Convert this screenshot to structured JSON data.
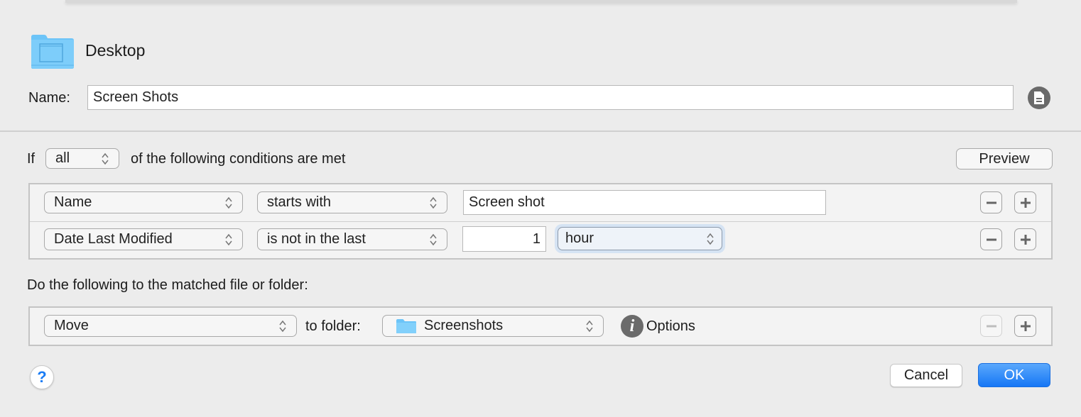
{
  "header": {
    "folder_name": "Desktop",
    "folder_icon": "folder-icon"
  },
  "name_field": {
    "label": "Name:",
    "value": "Screen Shots",
    "side_icon": "document-icon"
  },
  "conditions": {
    "prefix": "If",
    "match_mode": "all",
    "suffix": "of the following conditions are met",
    "preview_label": "Preview",
    "rows": [
      {
        "attribute": "Name",
        "operator": "starts with",
        "value": "Screen shot"
      },
      {
        "attribute": "Date Last Modified",
        "operator": "is not in the last",
        "amount": "1",
        "unit": "hour"
      }
    ]
  },
  "actions": {
    "heading": "Do the following to the matched file or folder:",
    "rows": [
      {
        "action": "Move",
        "connector": "to folder:",
        "destination": "Screenshots",
        "destination_icon": "folder-icon",
        "options_label": "Options",
        "options_icon": "info-icon",
        "remove_disabled": true
      }
    ]
  },
  "footer": {
    "help_label": "?",
    "cancel_label": "Cancel",
    "ok_label": "OK"
  },
  "colors": {
    "accent": "#1a7cf5",
    "folder": "#6cc4f8",
    "focus_ring": "#d5e3f3"
  }
}
